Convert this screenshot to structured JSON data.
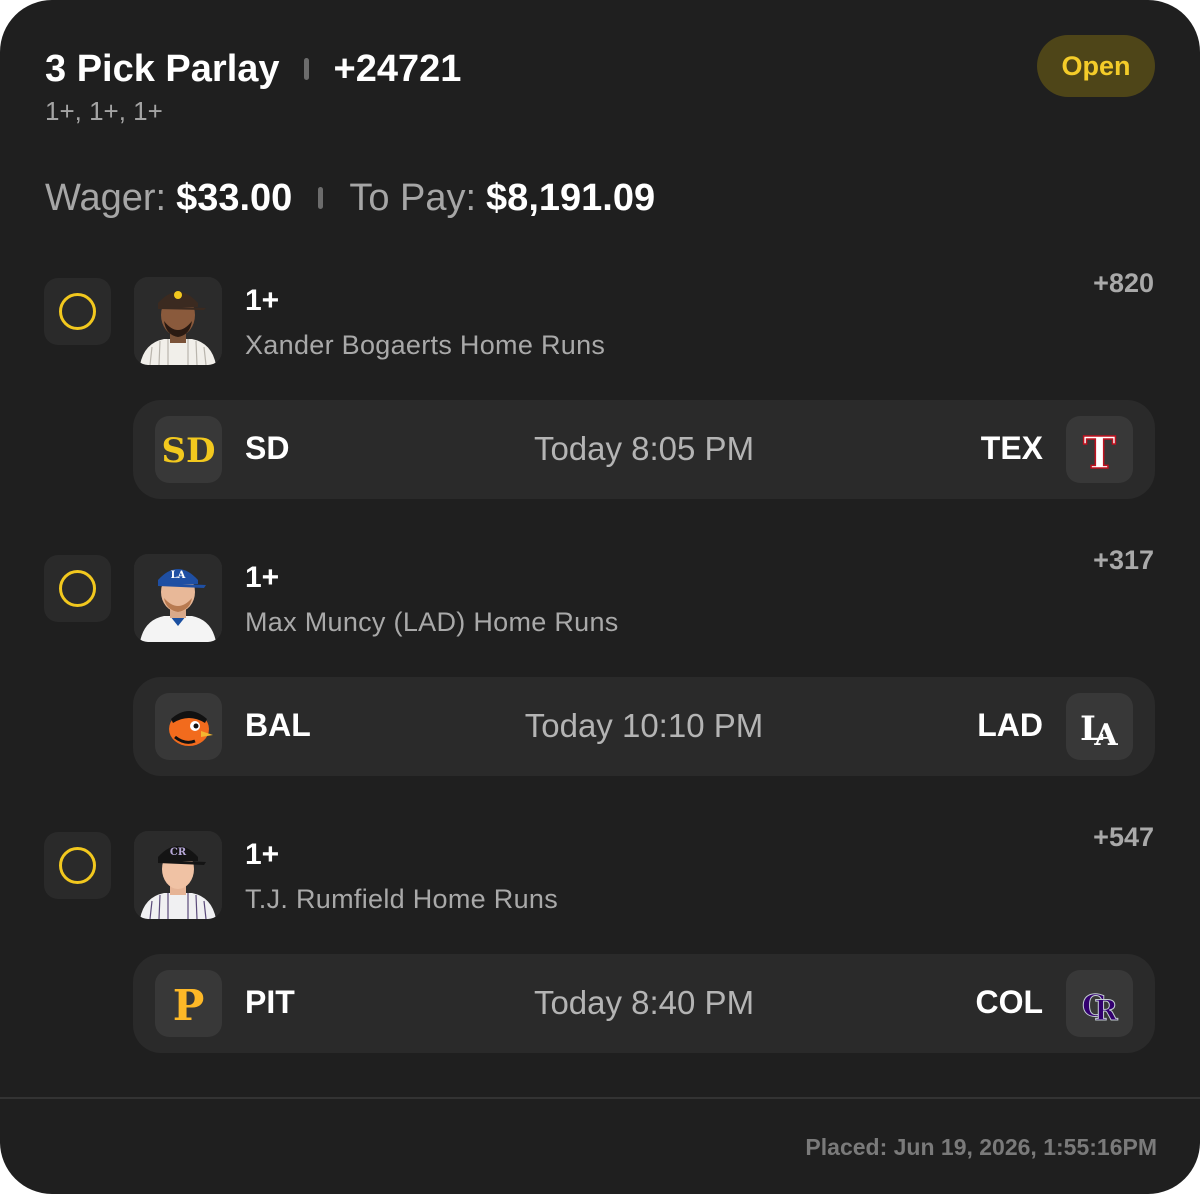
{
  "header": {
    "title": "3 Pick Parlay",
    "total_odds": "+24721",
    "subtitle": "1+, 1+, 1+",
    "status": "Open",
    "status_color": "#f4cc29"
  },
  "money": {
    "wager_label": "Wager:",
    "wager_value": "$33.00",
    "to_pay_label": "To Pay:",
    "to_pay_value": "$8,191.09"
  },
  "legs": [
    {
      "line": "1+",
      "description": "Xander Bogaerts Home Runs",
      "odds": "+820",
      "player_photo_icon": "player-headshot-padres",
      "game": {
        "away_abbr": "SD",
        "away_logo_icon": "padres-logo-icon",
        "time": "Today 8:05 PM",
        "home_abbr": "TEX",
        "home_logo_icon": "rangers-logo-icon"
      }
    },
    {
      "line": "1+",
      "description": "Max Muncy (LAD) Home Runs",
      "odds": "+317",
      "player_photo_icon": "player-headshot-dodgers",
      "game": {
        "away_abbr": "BAL",
        "away_logo_icon": "orioles-logo-icon",
        "time": "Today 10:10 PM",
        "home_abbr": "LAD",
        "home_logo_icon": "dodgers-logo-icon"
      }
    },
    {
      "line": "1+",
      "description": "T.J. Rumfield Home Runs",
      "odds": "+547",
      "player_photo_icon": "player-headshot-rockies",
      "game": {
        "away_abbr": "PIT",
        "away_logo_icon": "pirates-logo-icon",
        "time": "Today 8:40 PM",
        "home_abbr": "COL",
        "home_logo_icon": "rockies-logo-icon"
      }
    }
  ],
  "footer": {
    "placed": "Placed: Jun 19, 2026, 1:55:16PM"
  },
  "colors": {
    "background": "#1f1f1f",
    "accent_yellow": "#f2c81e",
    "muted_text": "#a9a9a9"
  }
}
